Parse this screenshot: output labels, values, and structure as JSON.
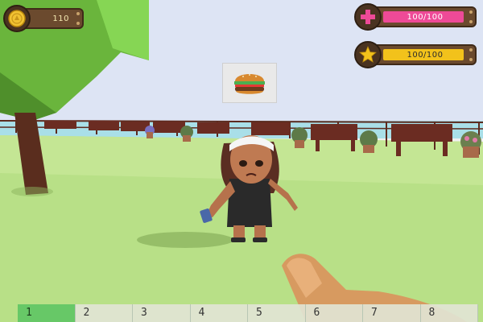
{
  "hud": {
    "coins": {
      "value": "110",
      "icon": "coin-icon"
    },
    "health": {
      "text": "100/100",
      "fill_fraction": 1.0,
      "color": "#ee4a97",
      "icon": "health-cross-icon"
    },
    "xp": {
      "text": "100/100",
      "fill_fraction": 1.0,
      "color": "#f2c21b",
      "icon": "star-icon"
    }
  },
  "quest": {
    "icon": "burger-icon"
  },
  "hotbar": {
    "active_index": 0,
    "slots": [
      "1",
      "2",
      "3",
      "4",
      "5",
      "6",
      "7",
      "8"
    ]
  },
  "colors": {
    "sky": "#dde4f4",
    "grass": "#b8e087",
    "tree": "#76c244",
    "active_slot": "#67c867"
  }
}
